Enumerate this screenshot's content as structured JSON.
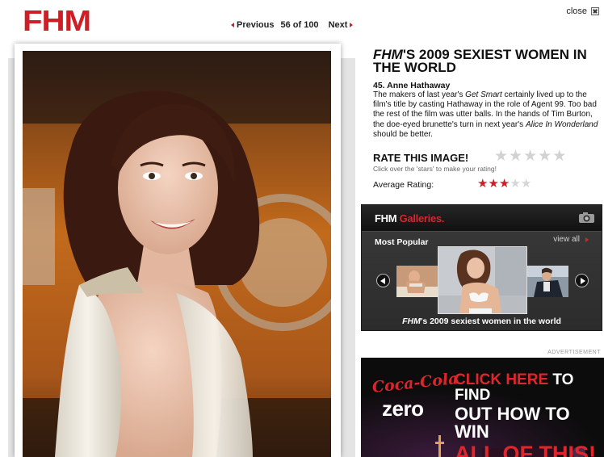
{
  "header": {
    "logo": "FHM",
    "previous_label": "Previous",
    "counter": "56 of 100",
    "next_label": "Next",
    "close_label": "close"
  },
  "article": {
    "headline_brand": "FHM",
    "headline_rest": "'S 2009 SEXIEST WOMEN IN THE WORLD",
    "entry_title": "45. Anne Hathaway",
    "body_1": "The makers of last year's ",
    "body_title_1": "Get Smart",
    "body_2": " certainly lived up to the film's title by casting Hathaway in the role of Agent 99. Too bad the rest of the film was utter balls. In the hands of Tim Burton, the doe-eyed brunette's turn in next year's ",
    "body_title_2": "Alice In Wonderland",
    "body_3": " should be better."
  },
  "rating": {
    "title": "RATE THIS IMAGE!",
    "hint": "Click over the 'stars' to make your rating!",
    "average_label": "Average Rating:",
    "average_stars": 3,
    "max_stars": 5,
    "star_glyph": "★"
  },
  "gallery": {
    "title_white": "FHM",
    "title_red": "Galleries.",
    "most_popular": "Most Popular",
    "view_all": "view all",
    "caption_brand": "FHM",
    "caption_rest": "'s 2009 sexiest women in the world",
    "icon": "camera-icon"
  },
  "ad": {
    "label": "ADVERTISEMENT",
    "brand": "Coca-Cola",
    "sub": "zero",
    "line1_red": "CLICK HERE",
    "line1_white": " TO FIND",
    "line2": "OUT HOW TO WIN",
    "line3": "ALL OF THIS!"
  },
  "colors": {
    "brand_red": "#cf1f26",
    "panel_dark": "#2c2c2c",
    "star_off": "#d2d2d2"
  }
}
